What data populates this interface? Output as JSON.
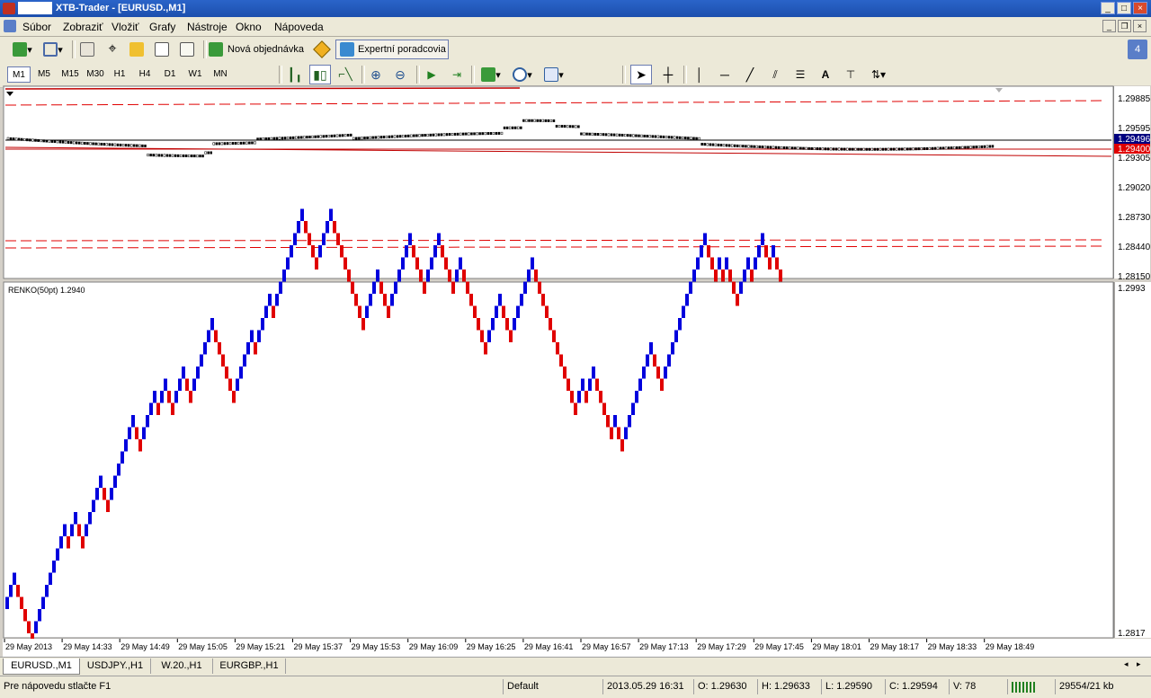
{
  "window": {
    "title": "XTB-Trader - [EURUSD.,M1]"
  },
  "menu": [
    "Súbor",
    "Zobraziť",
    "Vložiť",
    "Grafy",
    "Nástroje",
    "Okno",
    "Nápoveda"
  ],
  "toolbar": {
    "new_order": "Nová objednávka",
    "expert_advisors": "Expertní poradcovia",
    "notification_count": "4"
  },
  "timeframes": [
    "M1",
    "M5",
    "M15",
    "M30",
    "H1",
    "H4",
    "D1",
    "W1",
    "MN"
  ],
  "active_timeframe": "M1",
  "draw_tools": {
    "text_tool": "A"
  },
  "upper_axis": [
    "1.29885",
    "1.29595",
    "1.29305",
    "1.29020",
    "1.28730",
    "1.28440",
    "1.28150"
  ],
  "price_tags": {
    "ask": "1.29496",
    "bid": "1.29400"
  },
  "renko": {
    "label": "RENKO(50pt) 1.2940",
    "axis_top": "1.2993",
    "axis_bottom": "1.2817",
    "up_color": "#0000dd",
    "down_color": "#e00000",
    "time_labels": [
      "29 May 2013",
      "29 May 14:33",
      "29 May 14:49",
      "29 May 15:05",
      "29 May 15:21",
      "29 May 15:37",
      "29 May 15:53",
      "29 May 16:09",
      "29 May 16:25",
      "29 May 16:41",
      "29 May 16:57",
      "29 May 17:13",
      "29 May 17:29",
      "29 May 17:45",
      "29 May 18:01",
      "29 May 18:17",
      "29 May 18:33",
      "29 May 18:49"
    ]
  },
  "tabs": [
    "EURUSD.,M1",
    "USDJPY.,H1",
    "W.20.,H1",
    "EURGBP.,H1"
  ],
  "active_tab": 0,
  "status": {
    "help": "Pre nápovedu stlačte F1",
    "profile": "Default",
    "datetime": "2013.05.29 16:31",
    "open": "O: 1.29630",
    "high": "H: 1.29633",
    "low": "L: 1.29590",
    "close": "C: 1.29594",
    "volume": "V: 78",
    "traffic": "29554/21 kb"
  }
}
